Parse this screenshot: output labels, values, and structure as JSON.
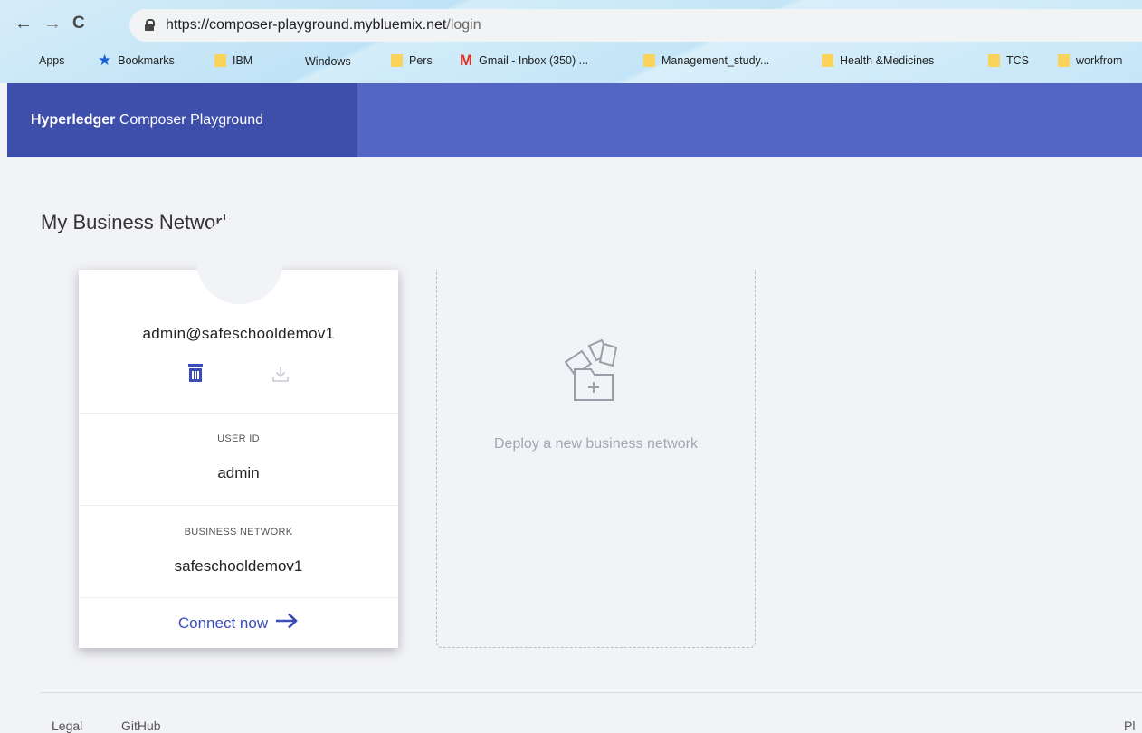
{
  "browser": {
    "nav": {
      "back": "←",
      "forward": "→",
      "reload": "C"
    },
    "url_host": "https://composer-playground.mybluemix.net",
    "url_path": "/login",
    "bookmarks": [
      {
        "label": "Apps",
        "icon": "apps-grid-icon"
      },
      {
        "label": "Bookmarks",
        "icon": "star-icon"
      },
      {
        "label": "IBM",
        "icon": "folder-icon"
      },
      {
        "label": "Windows",
        "icon": "windows-logo-icon"
      },
      {
        "label": "Pers",
        "icon": "folder-icon"
      },
      {
        "label": "Gmail - Inbox (350) ...",
        "icon": "gmail-icon"
      },
      {
        "label": "Management_study...",
        "icon": "folder-icon"
      },
      {
        "label": "Health &Medicines",
        "icon": "folder-icon"
      },
      {
        "label": "TCS",
        "icon": "folder-icon"
      },
      {
        "label": "workfrom",
        "icon": "folder-icon"
      }
    ]
  },
  "header": {
    "brand_bold": "Hyperledger",
    "brand_rest": " Composer Playground"
  },
  "main": {
    "title": "My Business Networks",
    "card": {
      "id_card_name": "admin@safeschooldemov1",
      "user_id_label": "USER ID",
      "user_id": "admin",
      "network_label": "BUSINESS NETWORK",
      "network": "safeschooldemov1",
      "connect_label": "Connect now",
      "connect_arrow": "→"
    },
    "deploy": {
      "label": "Deploy a new business network"
    }
  },
  "footer": {
    "links": [
      "Legal",
      "GitHub"
    ],
    "right_text": "Pl"
  },
  "colors": {
    "header": "#5466c3",
    "brand_bg": "#3e4eab",
    "accent": "#3a4cb8",
    "page_bg": "#f2f3f7"
  }
}
